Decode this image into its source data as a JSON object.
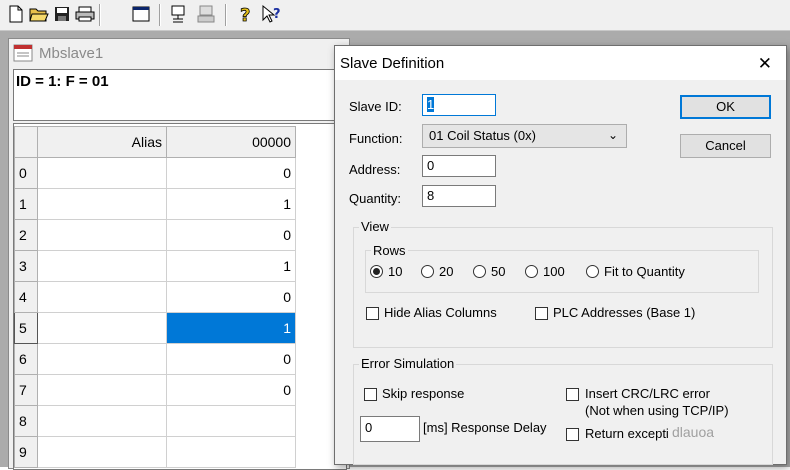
{
  "toolbar": {
    "icons": [
      "new-icon",
      "open-icon",
      "save-icon",
      "print-icon",
      "window-icon",
      "connect-icon",
      "disconnect-icon",
      "help-icon",
      "context-help-icon"
    ]
  },
  "child_window": {
    "title": "Mbslave1",
    "status": "ID = 1: F = 01",
    "grid": {
      "headers": [
        "",
        "Alias",
        "00000"
      ],
      "rows": [
        {
          "num": "0",
          "alias": "",
          "value": "0"
        },
        {
          "num": "1",
          "alias": "",
          "value": "1"
        },
        {
          "num": "2",
          "alias": "",
          "value": "0"
        },
        {
          "num": "3",
          "alias": "",
          "value": "1"
        },
        {
          "num": "4",
          "alias": "",
          "value": "0"
        },
        {
          "num": "5",
          "alias": "",
          "value": "1"
        },
        {
          "num": "6",
          "alias": "",
          "value": "0"
        },
        {
          "num": "7",
          "alias": "",
          "value": "0"
        },
        {
          "num": "8",
          "alias": "",
          "value": ""
        },
        {
          "num": "9",
          "alias": "",
          "value": ""
        }
      ],
      "selected_row": 5
    }
  },
  "dialog": {
    "title": "Slave Definition",
    "close": "✕",
    "slave_id_label": "Slave ID:",
    "slave_id_value": "1",
    "function_label": "Function:",
    "function_value": "01 Coil Status (0x)",
    "address_label": "Address:",
    "address_value": "0",
    "quantity_label": "Quantity:",
    "quantity_value": "8",
    "ok_label": "OK",
    "cancel_label": "Cancel",
    "view": {
      "label": "View",
      "rows_label": "Rows",
      "rows_options": [
        "10",
        "20",
        "50",
        "100",
        "Fit to Quantity"
      ],
      "rows_selected": "10",
      "hide_alias_label": "Hide Alias Columns",
      "plc_addresses_label": "PLC Addresses (Base 1)"
    },
    "error_sim": {
      "label": "Error Simulation",
      "skip_response_label": "Skip response",
      "delay_value": "0",
      "delay_label": "[ms] Response Delay",
      "crc_label": "Insert CRC/LRC error",
      "crc_note": "(Not when using TCP/IP)",
      "return_exception_label": "Return excepti"
    }
  },
  "watermark": "dlauoa",
  "colors": {
    "selection": "#0078d7",
    "dialog_bg": "#f0f0f0",
    "mdi_bg": "#ababab"
  }
}
